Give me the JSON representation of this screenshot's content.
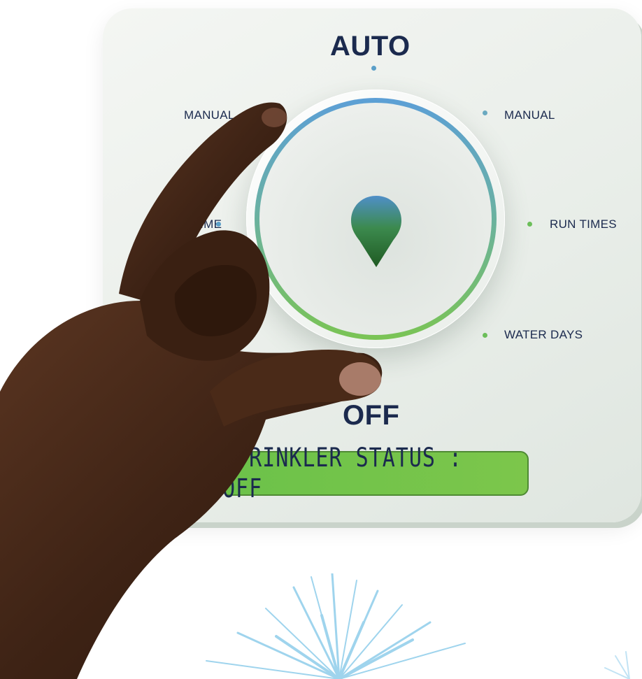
{
  "dial": {
    "top_label": "AUTO",
    "bottom_label": "OFF",
    "options_left": [
      "MANUAL",
      "RUN TIME"
    ],
    "options_right": [
      "MANUAL",
      "RUN TIMES",
      "WATER DAYS"
    ],
    "pointer_icon": "location-pin-icon",
    "ring_colors": [
      "#5c9fd6",
      "#7ac454"
    ]
  },
  "status": {
    "text": "SPRINKLER STATUS : OFF",
    "color": "#7cc64b"
  },
  "colors": {
    "label": "#1b2a4e",
    "dot_blue": "#5a9fc8",
    "dot_green": "#6cbf5a"
  }
}
